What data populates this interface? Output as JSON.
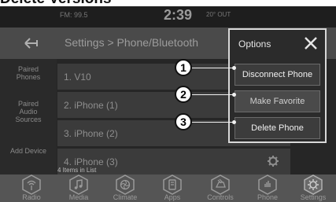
{
  "page_heading": "Delete Versions",
  "status": {
    "radio": "FM: 99.5",
    "clock": "2:39",
    "temperature": "20° OUT"
  },
  "header": {
    "breadcrumb": "Settings > Phone/Bluetooth",
    "back_icon": "back-arrow-icon"
  },
  "sidebar": {
    "items": [
      {
        "label": "Paired Phones"
      },
      {
        "label": "Paired Audio Sources"
      },
      {
        "label": "Add Device"
      }
    ]
  },
  "list": {
    "rows": [
      {
        "label": "1. V10"
      },
      {
        "label": "2. iPhone (1)"
      },
      {
        "label": "3. iPhone (2)"
      },
      {
        "label": "4. iPhone (3)"
      }
    ],
    "count_text": "4 Items in List"
  },
  "options_popup": {
    "title": "Options",
    "buttons": [
      {
        "label": "Disconnect Phone"
      },
      {
        "label": "Make Favorite"
      },
      {
        "label": "Delete Phone"
      }
    ]
  },
  "callouts": [
    "1",
    "2",
    "3"
  ],
  "bottom_bar": {
    "tabs": [
      {
        "label": "Radio",
        "icon": "radio-icon"
      },
      {
        "label": "Media",
        "icon": "media-icon"
      },
      {
        "label": "Climate",
        "icon": "climate-icon"
      },
      {
        "label": "Apps",
        "icon": "apps-icon"
      },
      {
        "label": "Controls",
        "icon": "controls-icon"
      },
      {
        "label": "Phone",
        "icon": "phone-icon"
      },
      {
        "label": "Settings",
        "icon": "settings-icon"
      }
    ]
  }
}
